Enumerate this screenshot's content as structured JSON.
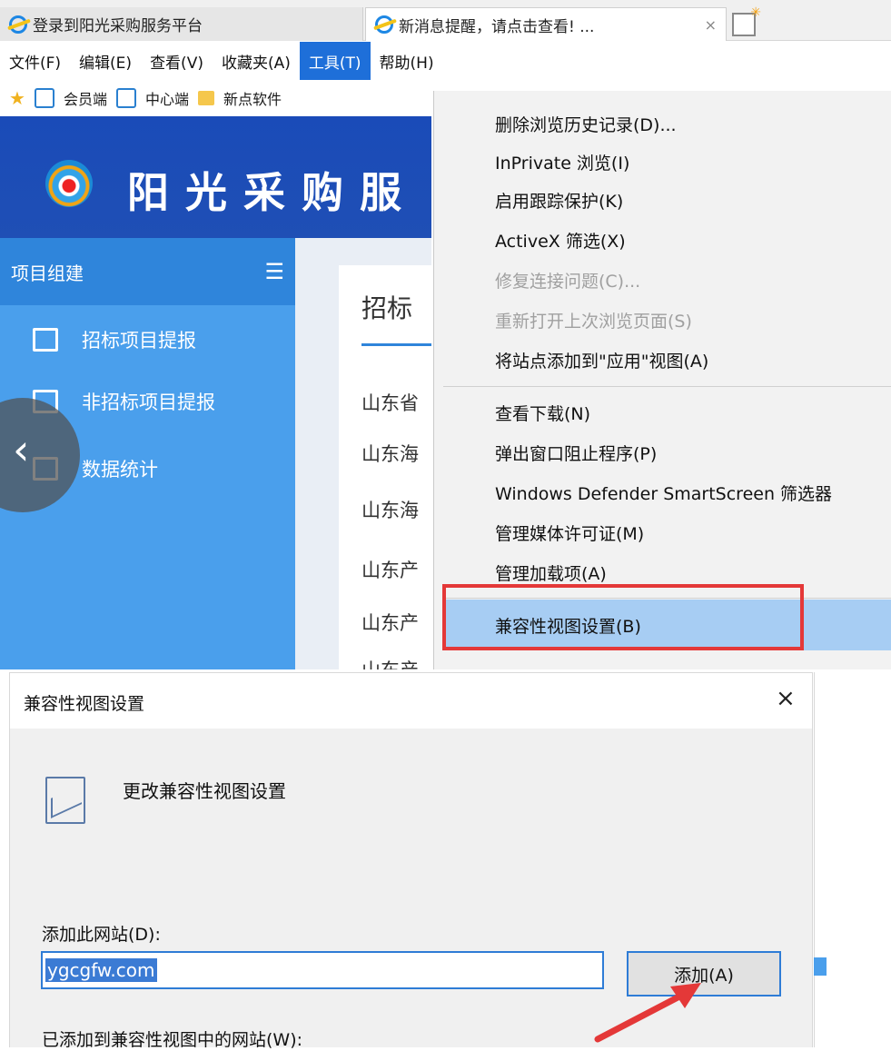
{
  "tabs": [
    {
      "title": "登录到阳光采购服务平台"
    },
    {
      "title": "新消息提醒，请点击查看! ...",
      "close": "×"
    }
  ],
  "menubar": [
    "文件(F)",
    "编辑(E)",
    "查看(V)",
    "收藏夹(A)",
    "工具(T)",
    "帮助(H)"
  ],
  "favorites": [
    "会员端",
    "中心端",
    "新点软件"
  ],
  "site": {
    "banner_title": "阳光采购服",
    "sidebar_title": "项目组建",
    "sidebar_items": [
      "招标项目提报",
      "非招标项目提报",
      "数据统计"
    ],
    "card_title": "招标",
    "card_rows": [
      "山东省",
      "山东海",
      "山东海",
      "山东产",
      "山东产",
      "山东产"
    ]
  },
  "tools_menu": [
    {
      "label": "删除浏览历史记录(D)...",
      "disabled": false
    },
    {
      "label": "InPrivate 浏览(I)",
      "disabled": false
    },
    {
      "label": "启用跟踪保护(K)",
      "disabled": false
    },
    {
      "label": "ActiveX 筛选(X)",
      "disabled": false
    },
    {
      "label": "修复连接问题(C)...",
      "disabled": true
    },
    {
      "label": "重新打开上次浏览页面(S)",
      "disabled": true
    },
    {
      "label": "将站点添加到\"应用\"视图(A)",
      "disabled": false
    },
    {
      "label": "查看下载(N)",
      "disabled": false
    },
    {
      "label": "弹出窗口阻止程序(P)",
      "disabled": false
    },
    {
      "label": "Windows Defender SmartScreen 筛选器",
      "disabled": false
    },
    {
      "label": "管理媒体许可证(M)",
      "disabled": false
    },
    {
      "label": "管理加载项(A)",
      "disabled": false
    },
    {
      "label": "兼容性视图设置(B)",
      "disabled": false,
      "highlighted": true
    }
  ],
  "dialog": {
    "title": "兼容性视图设置",
    "close": "×",
    "heading": "更改兼容性视图设置",
    "add_label": "添加此网站(D):",
    "url_value": "ygcgfw.com",
    "add_button": "添加(A)",
    "list_label": "已添加到兼容性视图中的网站(W):"
  },
  "colors": {
    "accent": "#1e6fd9",
    "highlight_red": "#e43838",
    "sidebar": "#4a9fec"
  }
}
